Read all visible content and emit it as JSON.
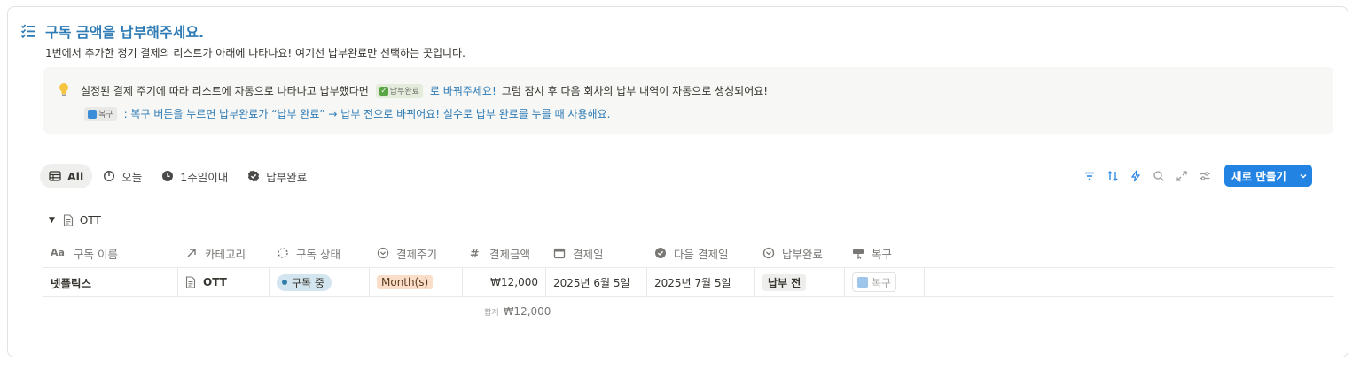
{
  "header": {
    "title": "구독 금액을 납부해주세요.",
    "description": "1번에서 추가한 정기 결제의 리스트가 아래에 나타나요! 여기선 납부완료만 선택하는 곳입니다."
  },
  "callout": {
    "line1_before": "설정된 결제 주기에 따라 리스트에 자동으로 나타나고 납부했다면",
    "line1_tag": "납부완료",
    "line1_link": "로 바꿔주세요!",
    "line1_after": "그럼 잠시 후 다음 회차의 납부 내역이 자동으로 생성되어요!",
    "line2_tag": "복구",
    "line2_text": ": 복구 버튼을 누르면 납부완료가 “납부 완료” → 납부 전으로 바뀌어요! 실수로 납부 완료를 누를 때 사용해요."
  },
  "views": [
    {
      "label": "All",
      "icon": "table-icon",
      "active": true
    },
    {
      "label": "오늘",
      "icon": "pie-icon"
    },
    {
      "label": "1주일이내",
      "icon": "clock-icon"
    },
    {
      "label": "납부완료",
      "icon": "check-badge-icon"
    }
  ],
  "toolbar": {
    "icons": [
      "filter-icon",
      "sort-icon",
      "lightning-icon",
      "search-icon",
      "expand-icon",
      "settings-icon"
    ],
    "new_button": "새로 만들기"
  },
  "group": {
    "name": "OTT"
  },
  "table": {
    "columns": [
      "구독 이름",
      "카테고리",
      "구독 상태",
      "결제주기",
      "결제금액",
      "결제일",
      "다음 결제일",
      "납부완료",
      "복구"
    ],
    "rows": [
      {
        "name": "넷플릭스",
        "category": "OTT",
        "status": "구독 중",
        "cycle": "Month(s)",
        "amount": "₩12,000",
        "pay_date": "2025년 6월 5일",
        "next_date": "2025년 7월 5일",
        "paid": "납부 전",
        "restore": "복구"
      }
    ],
    "sum_label": "합계",
    "sum_value": "₩12,000"
  },
  "colors": {
    "accent": "#2383e2",
    "title": "#2e7bb5",
    "status_pill": "#d3e5ef",
    "cycle_tag": "#fadec9"
  }
}
